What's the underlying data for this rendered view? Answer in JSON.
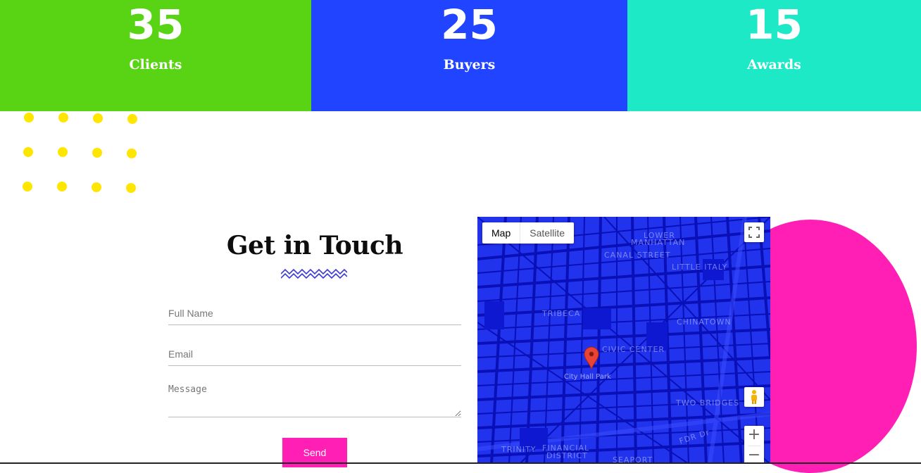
{
  "stats": [
    {
      "number": "35",
      "label": "Clients",
      "color": "#58d414"
    },
    {
      "number": "25",
      "label": "Buyers",
      "color": "#2044ff"
    },
    {
      "number": "15",
      "label": "Awards",
      "color": "#1de9c6"
    }
  ],
  "contact": {
    "heading": "Get in Touch",
    "full_name_placeholder": "Full Name",
    "email_placeholder": "Email",
    "message_placeholder": "Message",
    "send_label": "Send"
  },
  "map": {
    "type_map": "Map",
    "type_satellite": "Satellite",
    "labels": {
      "lower_manhattan_1": "LOWER",
      "lower_manhattan_2": "MANHATTAN",
      "canal_street": "CANAL STREET",
      "little_italy": "LITTLE ITALY",
      "tribeca": "TRIBECA",
      "chinatown": "CHINATOWN",
      "civic_center": "CIVIC CENTER",
      "two_bridges": "TWO BRIDGES",
      "trinity": "TRINITY",
      "financial_1": "FINANCIAL",
      "financial_2": "DISTRICT",
      "seaport": "SEAPORT",
      "fdr": "FDR Dr",
      "park": "City Hall Park"
    },
    "zoom_in": "+",
    "zoom_out": "−",
    "icons": {
      "fullscreen": "fullscreen-icon",
      "pegman": "pegman-icon",
      "pin": "map-pin-icon"
    }
  },
  "colors": {
    "accent_pink": "#ff1fb5",
    "dots": "#ffe600",
    "zigzag": "#3b3bd6",
    "map_water": "#1d2cf0"
  }
}
